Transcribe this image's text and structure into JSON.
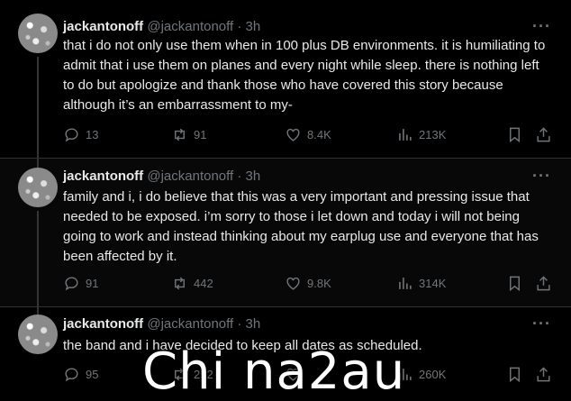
{
  "tweets": [
    {
      "name": "jackantonoff",
      "handle": "@jackantonoff",
      "time": "· 3h",
      "text": "that i do not only use them when in 100 plus DB environments. it is humiliating to admit that i use them on planes and every night while sleep. there is nothing left to do but apologize and thank those who have covered this story because although it’s an embarrassment to my-",
      "replies": "13",
      "retweets": "91",
      "likes": "8.4K",
      "views": "213K"
    },
    {
      "name": "jackantonoff",
      "handle": "@jackantonoff",
      "time": "· 3h",
      "text": "family and i, i do believe that this was a very important and pressing issue that needed to be exposed. i’m sorry to those i let down and today i will not being going to work and instead thinking about my earplug use and everyone that has been affected by it.",
      "replies": "91",
      "retweets": "442",
      "likes": "9.8K",
      "views": "314K"
    },
    {
      "name": "jackantonoff",
      "handle": "@jackantonoff",
      "time": "· 3h",
      "text": "the band and i have decided to keep all dates as scheduled.",
      "replies": "95",
      "retweets": "252",
      "likes": "",
      "views": "260K"
    }
  ],
  "watermark": "Chi na2au",
  "more_glyph": "···",
  "colors": {
    "background": "#000000",
    "text": "#e7e9ea",
    "muted": "#71767b",
    "divider": "#2f3336"
  }
}
